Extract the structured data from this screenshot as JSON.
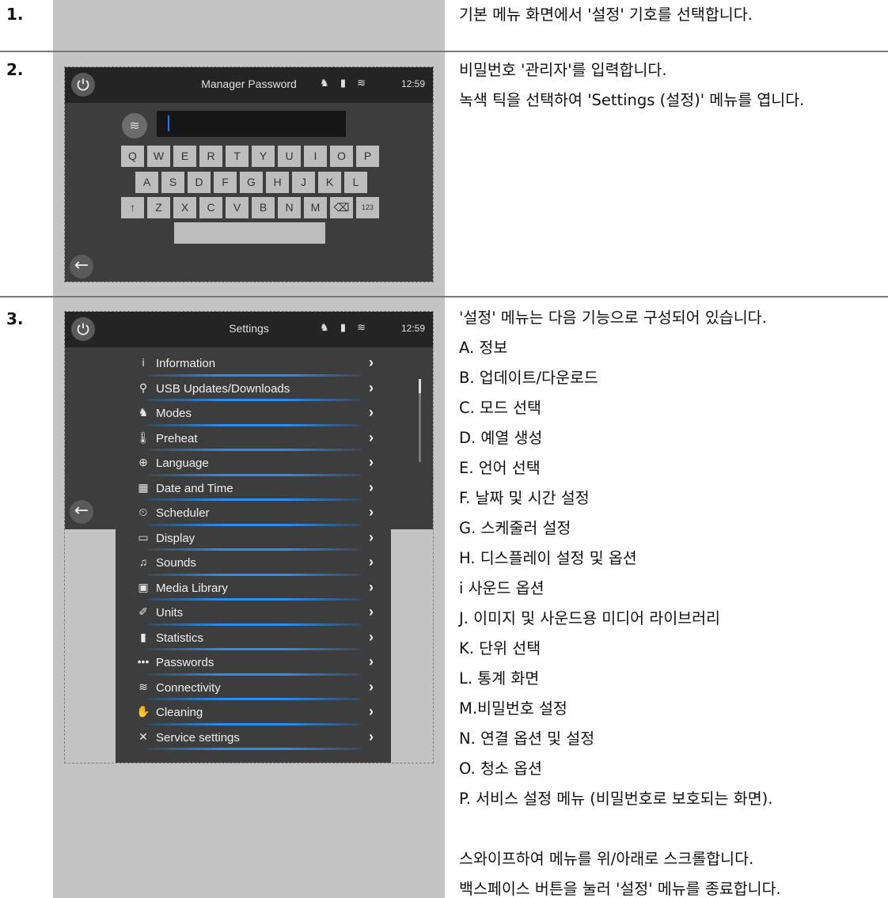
{
  "steps": [
    {
      "number": "1.",
      "lines": [
        "기본 메뉴 화면에서 '설정' 기호를 선택합니다."
      ]
    },
    {
      "number": "2.",
      "lines": [
        "비밀번호 '관리자'를 입력합니다.",
        "녹색 틱을 선택하여 'Settings (설정)' 메뉴를 엽니다."
      ],
      "screen": {
        "title": "Manager Password",
        "clock": "12:59",
        "keyboard": {
          "row1": [
            "Q",
            "W",
            "E",
            "R",
            "T",
            "Y",
            "U",
            "I",
            "O",
            "P"
          ],
          "row2": [
            "A",
            "S",
            "D",
            "F",
            "G",
            "H",
            "J",
            "K",
            "L"
          ],
          "row3": [
            "↑",
            "Z",
            "X",
            "C",
            "V",
            "B",
            "N",
            "M",
            "⌫",
            "123"
          ]
        }
      }
    },
    {
      "number": "3.",
      "lines": [
        "'설정' 메뉴는 다음 기능으로 구성되어 있습니다.",
        "A. 정보",
        "B. 업데이트/다운로드",
        "C. 모드 선택",
        "D. 예열 생성",
        "E. 언어 선택",
        "F. 날짜 및 시간 설정",
        "G. 스케줄러 설정",
        "H. 디스플레이 설정 및 옵션",
        "i   사운드 옵션",
        "J. 이미지 및 사운드용 미디어 라이브러리",
        "K. 단위 선택",
        "L. 통계 화면",
        "M.비밀번호 설정",
        "N. 연결 옵션 및 설정",
        "O. 청소 옵션",
        "P. 서비스 설정 메뉴 (비밀번호로 보호되는 화면).",
        "",
        "스와이프하여 메뉴를 위/아래로 스크롤합니다.",
        "백스페이스 버튼을 눌러 '설정' 메뉴를 종료합니다."
      ],
      "screen": {
        "title": "Settings",
        "clock": "12:59",
        "menu": [
          {
            "icon": "i",
            "label": "Information"
          },
          {
            "icon": "⚲",
            "label": "USB Updates/Downloads"
          },
          {
            "icon": "♞",
            "label": "Modes"
          },
          {
            "icon": "🌡",
            "label": "Preheat"
          },
          {
            "icon": "⊕",
            "label": "Language"
          },
          {
            "icon": "▦",
            "label": "Date and Time"
          },
          {
            "icon": "⏲",
            "label": "Scheduler"
          },
          {
            "icon": "▭",
            "label": "Display"
          },
          {
            "icon": "♫",
            "label": "Sounds"
          },
          {
            "icon": "▣",
            "label": "Media Library"
          },
          {
            "icon": "✐",
            "label": "Units"
          },
          {
            "icon": "▮",
            "label": "Statistics"
          },
          {
            "icon": "•••",
            "label": "Passwords"
          },
          {
            "icon": "≋",
            "label": "Connectivity"
          },
          {
            "icon": "✋",
            "label": "Cleaning"
          },
          {
            "icon": "✕",
            "label": "Service settings"
          }
        ],
        "chevron": "›"
      }
    }
  ],
  "status_icons": "♞ ▮ ≋",
  "colors": {
    "accent_underline": "#2b8ef0",
    "cursor": "#1e78ff",
    "screen_bg": "#3d3d3d",
    "status_bg": "#242424"
  }
}
